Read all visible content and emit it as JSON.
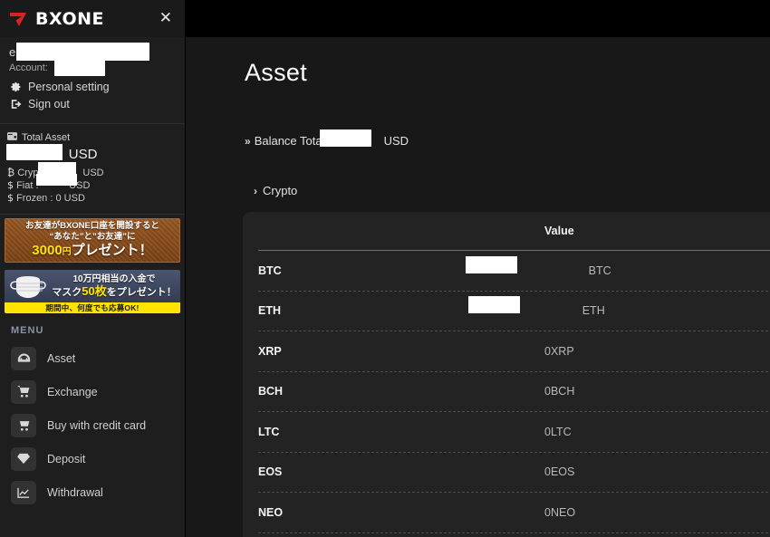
{
  "sidebar": {
    "logo_text": "BXONE",
    "close_label": "✕",
    "account": {
      "email_redacted": "",
      "account_label": "Account:",
      "account_redacted": "",
      "links": [
        {
          "label": "Personal setting",
          "icon": "gear-icon"
        },
        {
          "label": "Sign out",
          "icon": "sign-out-icon"
        }
      ]
    },
    "total_asset": {
      "heading": "Total Asset",
      "heading_icon": "wallet-icon",
      "total_value_redacted": "",
      "total_unit": "USD",
      "rows": [
        {
          "symbol": "₿",
          "label": "Crypto :",
          "value_redacted": "",
          "unit": "USD"
        },
        {
          "symbol": "$",
          "label": "Fiat :",
          "value_redacted": "",
          "unit": "USD"
        },
        {
          "symbol": "$",
          "label": "Frozen :",
          "value": "0 USD",
          "unit": ""
        }
      ]
    },
    "banners": [
      {
        "name": "referral-banner",
        "line1": "お友達がBXONE口座を開設すると",
        "line2": "“あなた”と”お友達”に",
        "line3_amount": "3000",
        "line3_yen": "円",
        "line3_rest": "プレゼント！",
        "bg_color": "#8a4f1f",
        "accent_color": "#ffe400"
      },
      {
        "name": "mask-campaign-banner",
        "line1": "10万円相当の入金で",
        "line2_a": "マスク",
        "line2_b": "50枚",
        "line2_c": "をプレゼント！",
        "strip": "期間中、何度でも応募OK!",
        "bg_color": "#3b455c",
        "strip_color": "#ffe400"
      }
    ],
    "menu_label": "MENU",
    "menu": [
      {
        "label": "Asset",
        "icon": "gauge-icon"
      },
      {
        "label": "Exchange",
        "icon": "cart-icon"
      },
      {
        "label": "Buy with credit card",
        "icon": "cart-icon"
      },
      {
        "label": "Deposit",
        "icon": "diamond-icon"
      },
      {
        "label": "Withdrawal",
        "icon": "chart-icon"
      }
    ]
  },
  "main": {
    "page_title": "Asset",
    "balance": {
      "chevron": "»",
      "label": "Balance Total :",
      "value_redacted": "",
      "unit": "USD"
    },
    "crypto_section": {
      "chevron": "›",
      "label": "Crypto"
    },
    "table": {
      "columns": [
        "",
        "Value"
      ],
      "rows": [
        {
          "symbol": "BTC",
          "value": "",
          "unit": "BTC",
          "redacted": true
        },
        {
          "symbol": "ETH",
          "value": "",
          "unit": "ETH",
          "redacted": true
        },
        {
          "symbol": "XRP",
          "value": "0",
          "unit": "XRP",
          "redacted": false
        },
        {
          "symbol": "BCH",
          "value": "0",
          "unit": "BCH",
          "redacted": false
        },
        {
          "symbol": "LTC",
          "value": "0",
          "unit": "LTC",
          "redacted": false
        },
        {
          "symbol": "EOS",
          "value": "0",
          "unit": "EOS",
          "redacted": false
        },
        {
          "symbol": "NEO",
          "value": "0",
          "unit": "NEO",
          "redacted": false
        }
      ]
    }
  },
  "colors": {
    "sidebar_bg": "#1e1e1e",
    "main_bg": "#181818",
    "panel_bg": "#232323",
    "topbar_bg": "#000000",
    "logo_red": "#e02020",
    "menu_label": "#8a93a5"
  }
}
